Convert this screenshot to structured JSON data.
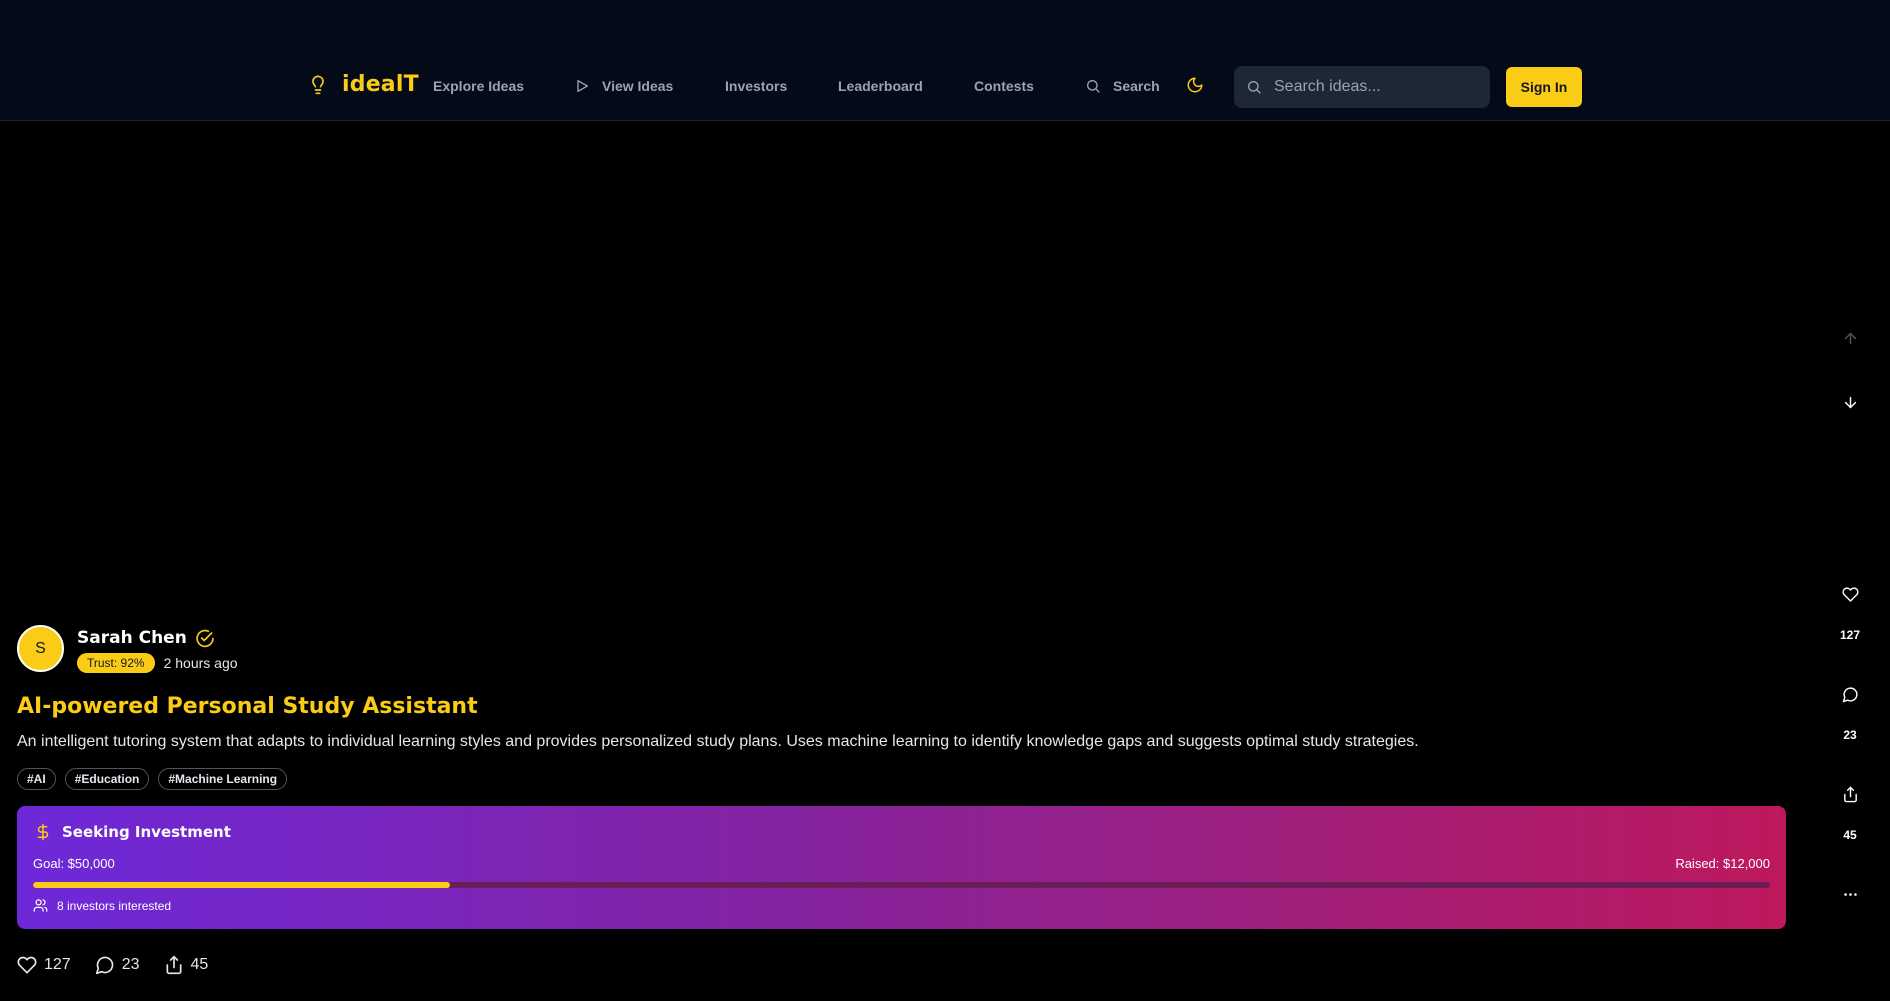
{
  "colors": {
    "accent": "#facc15",
    "header_bg": "#050a18",
    "page_bg": "#000000",
    "card_gradient_start": "#6d28d9",
    "card_gradient_end": "#be185d"
  },
  "header": {
    "logo_icon": "lightbulb-icon",
    "logo_text": "idealT",
    "nav": [
      {
        "label": "Explore Ideas",
        "icon": null
      },
      {
        "label": "View Ideas",
        "icon": "play-icon"
      },
      {
        "label": "Investors",
        "icon": null
      },
      {
        "label": "Leaderboard",
        "icon": null
      },
      {
        "label": "Contests",
        "icon": null
      },
      {
        "label": "Search",
        "icon": "search-icon"
      }
    ],
    "theme_icon": "moon-icon",
    "search_placeholder": "Search ideas...",
    "signin_label": "Sign In"
  },
  "rail": {
    "up_icon": "arrow-up-icon",
    "down_icon": "arrow-down-icon",
    "likes": "127",
    "comments": "23",
    "shares": "45",
    "more_icon": "more-dots-icon"
  },
  "post": {
    "avatar_initial": "S",
    "author": "Sarah Chen",
    "trust": "Trust: 92%",
    "time": "2 hours ago",
    "title": "AI-powered Personal Study Assistant",
    "description": "An intelligent tutoring system that adapts to individual learning styles and provides personalized study plans. Uses machine learning to identify knowledge gaps and suggests optimal study strategies.",
    "tags": [
      "#AI",
      "#Education",
      "#Machine Learning"
    ],
    "investment": {
      "title": "Seeking Investment",
      "goal": "Goal: $50,000",
      "raised": "Raised: $12,000",
      "progress_fraction": 0.24,
      "interested": "8 investors interested"
    },
    "stats": {
      "likes": "127",
      "comments": "23",
      "shares": "45"
    }
  }
}
